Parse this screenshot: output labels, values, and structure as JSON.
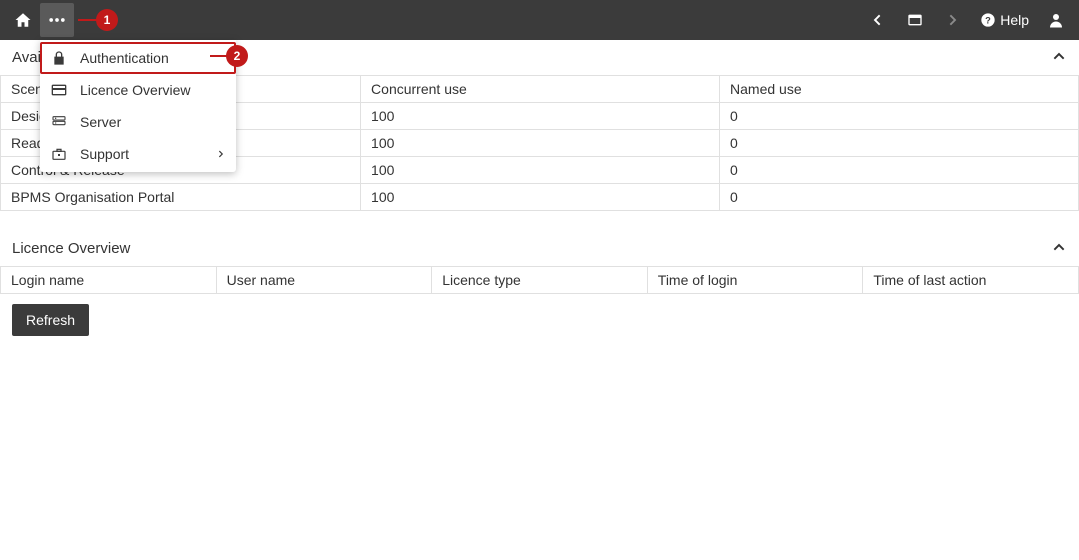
{
  "annotations": {
    "marker1": "1",
    "marker2": "2"
  },
  "topbar": {
    "help_label": "Help"
  },
  "menu": {
    "items": [
      {
        "icon": "lock-icon",
        "label": "Authentication"
      },
      {
        "icon": "card-icon",
        "label": "Licence Overview"
      },
      {
        "icon": "server-icon",
        "label": "Server"
      },
      {
        "icon": "support-icon",
        "label": "Support",
        "has_submenu": true
      }
    ]
  },
  "section_available": {
    "title": "Available licences",
    "columns": [
      "Scenario",
      "Concurrent use",
      "Named use"
    ],
    "rows": [
      {
        "scenario": "Design & Document",
        "concurrent": "100",
        "named": "0"
      },
      {
        "scenario": "Read & Explore",
        "concurrent": "100",
        "named": "0"
      },
      {
        "scenario": "Control & Release",
        "concurrent": "100",
        "named": "0"
      },
      {
        "scenario": "BPMS Organisation Portal",
        "concurrent": "100",
        "named": "0"
      }
    ]
  },
  "section_overview": {
    "title": "Licence Overview",
    "columns": [
      "Login name",
      "User name",
      "Licence type",
      "Time of login",
      "Time of last action"
    ]
  },
  "buttons": {
    "refresh": "Refresh"
  }
}
